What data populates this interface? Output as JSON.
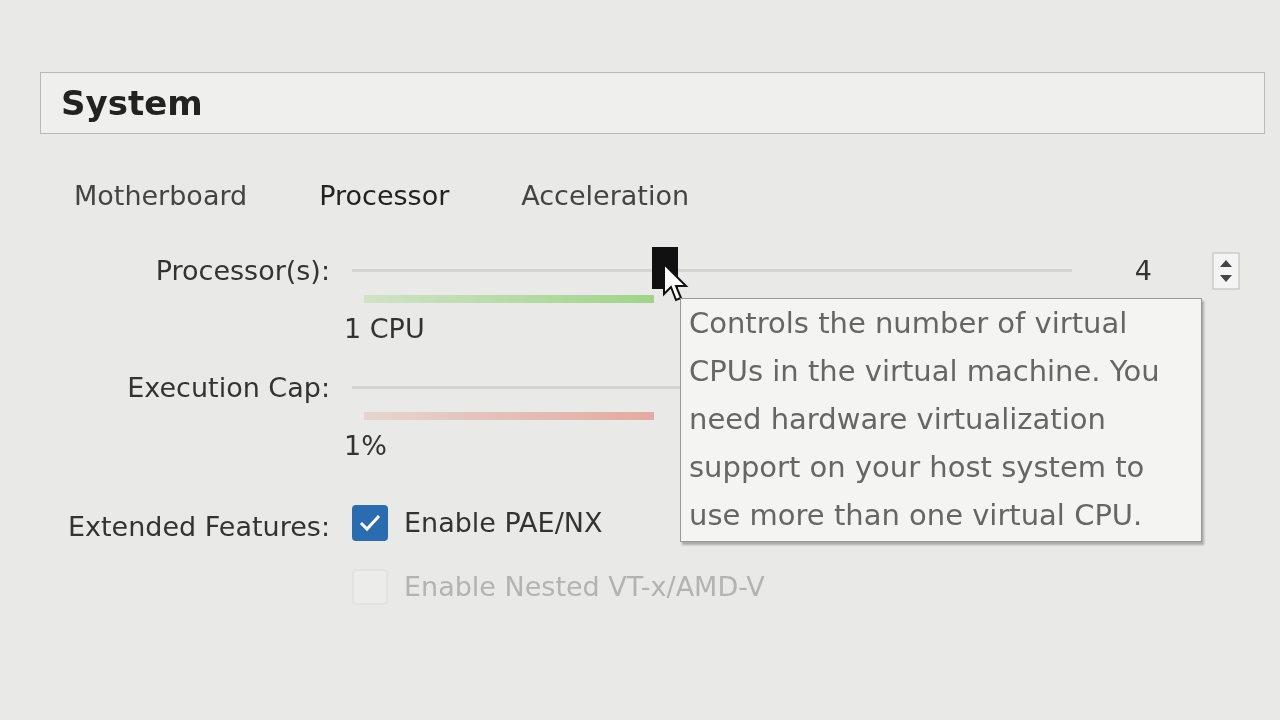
{
  "section_title": "System",
  "tabs": [
    {
      "label": "Motherboard",
      "selected": false
    },
    {
      "label": "Processor",
      "selected": true
    },
    {
      "label": "Acceleration",
      "selected": false
    }
  ],
  "processor": {
    "label": "Processor(s):",
    "level": 0.42,
    "value": "4",
    "min_label": "1 CPU"
  },
  "execution_cap": {
    "label": "Execution Cap:",
    "min_label": "1%"
  },
  "extended_features": {
    "label": "Extended Features:",
    "options": [
      {
        "label": "Enable PAE/NX",
        "checked": true,
        "disabled": false
      },
      {
        "label": "Enable Nested VT-x/AMD-V",
        "checked": false,
        "disabled": true
      }
    ]
  },
  "tooltip": {
    "text": "Controls the number of virtual CPUs in the virtual machine. You need hardware virtualization support on your host system to use more than one virtual CPU."
  }
}
